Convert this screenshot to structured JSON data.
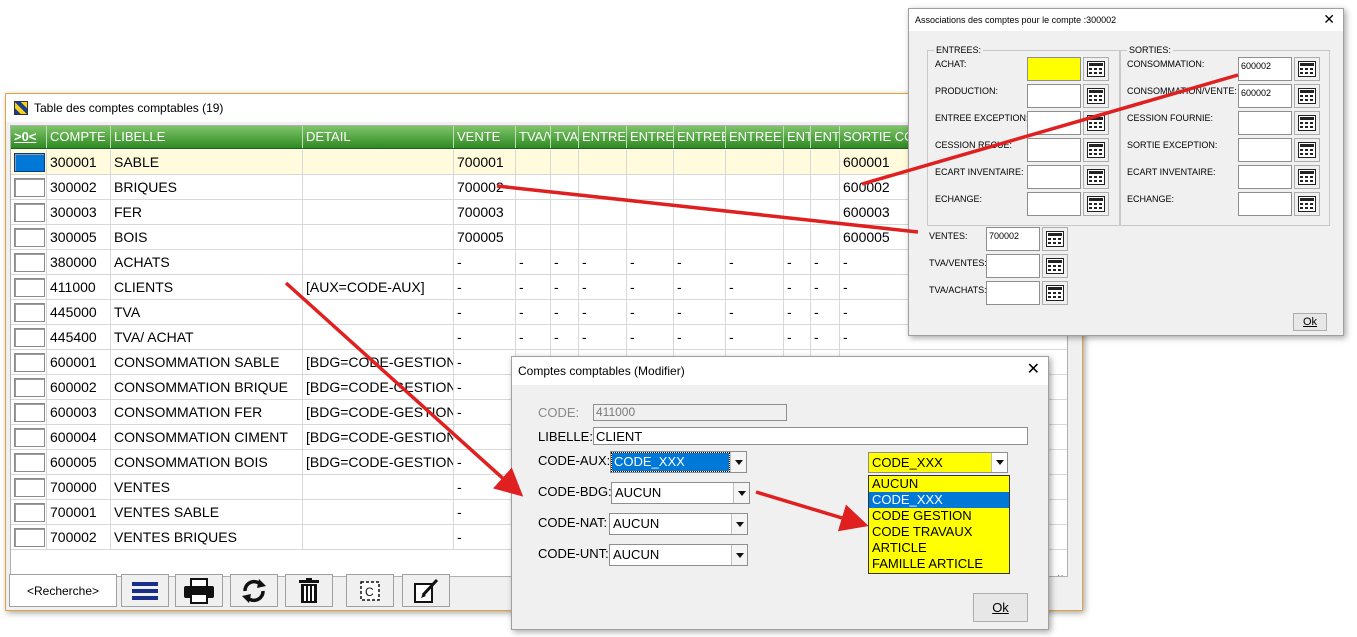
{
  "main_window": {
    "title": "Table des comptes comptables (19)",
    "columns": [
      ">0<",
      "COMPTE",
      "LIBELLE",
      "DETAIL",
      "VENTE",
      "TVA/V",
      "TVA",
      "ENTREE",
      "ENTRE",
      "ENTREE",
      "ENTREE",
      "ENT",
      "ENT",
      "SORTIE CO"
    ],
    "rows": [
      {
        "compte": "300001",
        "libelle": "SABLE",
        "detail": "",
        "vente": "700001",
        "c5": "",
        "c6": "",
        "c7": "",
        "c8": "",
        "c9": "",
        "c10": "",
        "c11": "",
        "c12": "",
        "sortie": "600001"
      },
      {
        "compte": "300002",
        "libelle": "BRIQUES",
        "detail": "",
        "vente": "700002",
        "c5": "",
        "c6": "",
        "c7": "",
        "c8": "",
        "c9": "",
        "c10": "",
        "c11": "",
        "c12": "",
        "sortie": "600002"
      },
      {
        "compte": "300003",
        "libelle": "FER",
        "detail": "",
        "vente": "700003",
        "c5": "",
        "c6": "",
        "c7": "",
        "c8": "",
        "c9": "",
        "c10": "",
        "c11": "",
        "c12": "",
        "sortie": "600003"
      },
      {
        "compte": "300005",
        "libelle": "BOIS",
        "detail": "",
        "vente": "700005",
        "c5": "",
        "c6": "",
        "c7": "",
        "c8": "",
        "c9": "",
        "c10": "",
        "c11": "",
        "c12": "",
        "sortie": "600005"
      },
      {
        "compte": "380000",
        "libelle": "ACHATS",
        "detail": "",
        "vente": "-",
        "c5": "-",
        "c6": "-",
        "c7": "-",
        "c8": "-",
        "c9": "-",
        "c10": "-",
        "c11": "-",
        "c12": "-",
        "sortie": "-"
      },
      {
        "compte": "411000",
        "libelle": "CLIENTS",
        "detail": "[AUX=CODE-AUX]",
        "vente": "-",
        "c5": "-",
        "c6": "-",
        "c7": "-",
        "c8": "-",
        "c9": "-",
        "c10": "-",
        "c11": "-",
        "c12": "-",
        "sortie": "-"
      },
      {
        "compte": "445000",
        "libelle": "TVA",
        "detail": "",
        "vente": "-",
        "c5": "-",
        "c6": "-",
        "c7": "-",
        "c8": "-",
        "c9": "-",
        "c10": "-",
        "c11": "-",
        "c12": "-",
        "sortie": "-"
      },
      {
        "compte": "445400",
        "libelle": "TVA/ ACHAT",
        "detail": "",
        "vente": "-",
        "c5": "-",
        "c6": "-",
        "c7": "-",
        "c8": "-",
        "c9": "-",
        "c10": "-",
        "c11": "-",
        "c12": "-",
        "sortie": "-"
      },
      {
        "compte": "600001",
        "libelle": "CONSOMMATION SABLE",
        "detail": "[BDG=CODE-GESTION]",
        "vente": "-",
        "c5": "",
        "c6": "",
        "c7": "",
        "c8": "",
        "c9": "",
        "c10": "",
        "c11": "",
        "c12": "",
        "sortie": ""
      },
      {
        "compte": "600002",
        "libelle": "CONSOMMATION BRIQUE",
        "detail": "[BDG=CODE-GESTION]",
        "vente": "-",
        "c5": "",
        "c6": "",
        "c7": "",
        "c8": "",
        "c9": "",
        "c10": "",
        "c11": "",
        "c12": "",
        "sortie": ""
      },
      {
        "compte": "600003",
        "libelle": "CONSOMMATION FER",
        "detail": "[BDG=CODE-GESTION]",
        "vente": "-",
        "c5": "",
        "c6": "",
        "c7": "",
        "c8": "",
        "c9": "",
        "c10": "",
        "c11": "",
        "c12": "",
        "sortie": ""
      },
      {
        "compte": "600004",
        "libelle": "CONSOMMATION CIMENT",
        "detail": "[BDG=CODE-GESTION]",
        "vente": "-",
        "c5": "",
        "c6": "",
        "c7": "",
        "c8": "",
        "c9": "",
        "c10": "",
        "c11": "",
        "c12": "",
        "sortie": ""
      },
      {
        "compte": "600005",
        "libelle": "CONSOMMATION BOIS",
        "detail": "[BDG=CODE-GESTION]",
        "vente": "-",
        "c5": "",
        "c6": "",
        "c7": "",
        "c8": "",
        "c9": "",
        "c10": "",
        "c11": "",
        "c12": "",
        "sortie": ""
      },
      {
        "compte": "700000",
        "libelle": "VENTES",
        "detail": "",
        "vente": "-",
        "c5": "",
        "c6": "",
        "c7": "",
        "c8": "",
        "c9": "",
        "c10": "",
        "c11": "",
        "c12": "",
        "sortie": ""
      },
      {
        "compte": "700001",
        "libelle": "VENTES SABLE",
        "detail": "",
        "vente": "-",
        "c5": "",
        "c6": "",
        "c7": "",
        "c8": "",
        "c9": "",
        "c10": "",
        "c11": "",
        "c12": "",
        "sortie": ""
      },
      {
        "compte": "700002",
        "libelle": "VENTES BRIQUES",
        "detail": "",
        "vente": "-",
        "c5": "",
        "c6": "",
        "c7": "",
        "c8": "",
        "c9": "",
        "c10": "",
        "c11": "",
        "c12": "",
        "sortie": ""
      }
    ],
    "toolbar": {
      "search_label": "<Recherche>",
      "icons": [
        "menu-icon",
        "print-icon",
        "refresh-icon",
        "delete-icon",
        "copy-icon",
        "edit-icon"
      ]
    }
  },
  "assoc_dialog": {
    "title": "Associations des comptes pour le compte :300002",
    "entrees_title": "ENTREES:",
    "sorties_title": "SORTIES:",
    "entrees": [
      {
        "label": "ACHAT:",
        "value": ""
      },
      {
        "label": "PRODUCTION:",
        "value": ""
      },
      {
        "label": "ENTREE EXCEPTION:",
        "value": ""
      },
      {
        "label": "CESSION RECUE:",
        "value": ""
      },
      {
        "label": "ECART INVENTAIRE:",
        "value": ""
      },
      {
        "label": "ECHANGE:",
        "value": ""
      }
    ],
    "sorties": [
      {
        "label": "CONSOMMATION:",
        "value": "600002"
      },
      {
        "label": "CONSOMMATION/VENTE:",
        "value": "600002"
      },
      {
        "label": "CESSION FOURNIE:",
        "value": ""
      },
      {
        "label": "SORTIE EXCEPTION:",
        "value": ""
      },
      {
        "label": "ECART INVENTAIRE:",
        "value": ""
      },
      {
        "label": "ECHANGE:",
        "value": ""
      }
    ],
    "ventes": {
      "label": "VENTES:",
      "value": "700002"
    },
    "tva_ventes": {
      "label": "TVA/VENTES:",
      "value": ""
    },
    "tva_achats": {
      "label": "TVA/ACHATS:",
      "value": ""
    },
    "ok_label": "Ok",
    "highlight_color": "#ffff00"
  },
  "modify_dialog": {
    "title": "Comptes comptables  (Modifier)",
    "code_label": "CODE:",
    "code_value": "411000",
    "libelle_label": "LIBELLE:",
    "libelle_value": "CLIENT",
    "aux_label": "CODE-AUX:",
    "aux_value": "CODE_XXX",
    "bdg_label": "CODE-BDG:",
    "bdg_value": "AUCUN",
    "nat_label": "CODE-NAT:",
    "nat_value": "AUCUN",
    "unt_label": "CODE-UNT:",
    "unt_value": "AUCUN",
    "ok_label": "Ok"
  },
  "dropdown": {
    "selected": "CODE_XXX",
    "options": [
      "AUCUN",
      "CODE_XXX",
      "CODE GESTION",
      "CODE TRAVAUX",
      "ARTICLE",
      "FAMILLE ARTICLE"
    ],
    "selected_index": 1,
    "background": "#ffff00"
  },
  "colors": {
    "header_green": "#2f8a22",
    "selection_blue": "#0078d7",
    "arrow_red": "#e02020",
    "window_border": "#e5a33a"
  }
}
